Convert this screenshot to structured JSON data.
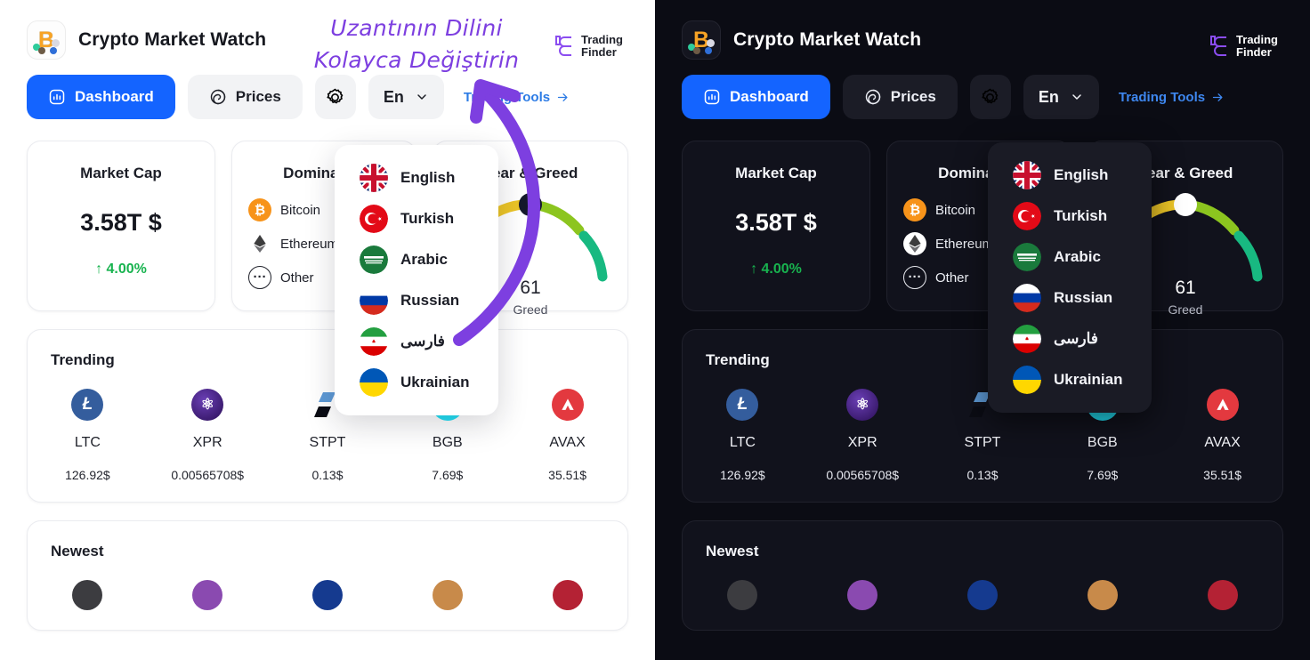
{
  "header": {
    "app_title": "Crypto Market Watch",
    "logo_icon": "bitcoin-network-icon",
    "brand": {
      "line1": "Trading",
      "line2": "Finder",
      "mark_icon": "tradingfinder-logo-icon"
    }
  },
  "nav": {
    "dashboard_label": "Dashboard",
    "dashboard_icon": "chart-square-icon",
    "prices_label": "Prices",
    "prices_icon": "spiral-icon",
    "settings_icon": "gear-icon",
    "language_value": "En",
    "language_chevron_icon": "chevron-down-icon",
    "tools_label": "Trading Tools",
    "tools_arrow_icon": "arrow-right-icon"
  },
  "language_menu": {
    "items": [
      {
        "label": "English",
        "flag": "flag-uk"
      },
      {
        "label": "Turkish",
        "flag": "flag-tr"
      },
      {
        "label": "Arabic",
        "flag": "flag-sa"
      },
      {
        "label": "Russian",
        "flag": "flag-ru"
      },
      {
        "label": "فارسی",
        "flag": "flag-ir"
      },
      {
        "label": "Ukrainian",
        "flag": "flag-ua"
      }
    ]
  },
  "market_cap": {
    "title": "Market Cap",
    "value": "3.58T $",
    "change": "4.00%",
    "change_arrow_icon": "arrow-up-icon",
    "change_color": "#18b34f"
  },
  "dominance": {
    "title": "Dominance",
    "rows": [
      {
        "name": "Bitcoin",
        "icon": "bitcoin-icon",
        "color": "#f7931a"
      },
      {
        "name": "Ethereum",
        "icon": "ethereum-icon",
        "color": "#ffffff"
      },
      {
        "name": "Other",
        "icon": "ellipsis-icon",
        "color": "transparent"
      }
    ]
  },
  "fear_greed": {
    "title": "Fear & Greed",
    "value": "61",
    "label": "Greed",
    "gauge_colors": [
      "#f08b26",
      "#ecc527",
      "#8cc51f",
      "#18b981"
    ]
  },
  "trending": {
    "title": "Trending",
    "coins": [
      {
        "symbol": "LTC",
        "price": "126.92$",
        "icon": "litecoin-icon",
        "color": "#345d9d",
        "glyph": "Ł"
      },
      {
        "symbol": "XPR",
        "price": "0.00565708$",
        "icon": "proton-icon",
        "color": "#3c1a6e",
        "glyph": "⚛"
      },
      {
        "symbol": "STPT",
        "price": "0.13$",
        "icon": "stpt-icon",
        "color": "#5e9ad6",
        "glyph": ""
      },
      {
        "symbol": "BGB",
        "price": "7.69$",
        "icon": "bitget-icon",
        "color": "#22e0f5",
        "glyph": "S"
      },
      {
        "symbol": "AVAX",
        "price": "35.51$",
        "icon": "avalanche-icon",
        "color": "#e3393f",
        "glyph": "A"
      }
    ]
  },
  "newest": {
    "title": "Newest",
    "avatars": [
      {
        "icon": "avatar-dark-icon",
        "color": "#3c3c40"
      },
      {
        "icon": "avatar-purple-icon",
        "color": "#8a4ab0"
      },
      {
        "icon": "avatar-blue-icon",
        "color": "#153a8f"
      },
      {
        "icon": "avatar-tan-icon",
        "color": "#c88a4a"
      },
      {
        "icon": "avatar-flag-icon",
        "color": "#b42234"
      }
    ]
  },
  "annotation": {
    "text_line1": "Uzantının Dilini",
    "text_line2": "Kolayca Değiştirin",
    "color": "#7d3fe0",
    "arrow_icon": "curved-arrow-icon"
  },
  "theme": {
    "light_bg": "#ffffff",
    "dark_bg": "#0b0c14",
    "dark_card_bg": "#11121c",
    "accent": "#1464ff",
    "link": "#2c7be5"
  }
}
